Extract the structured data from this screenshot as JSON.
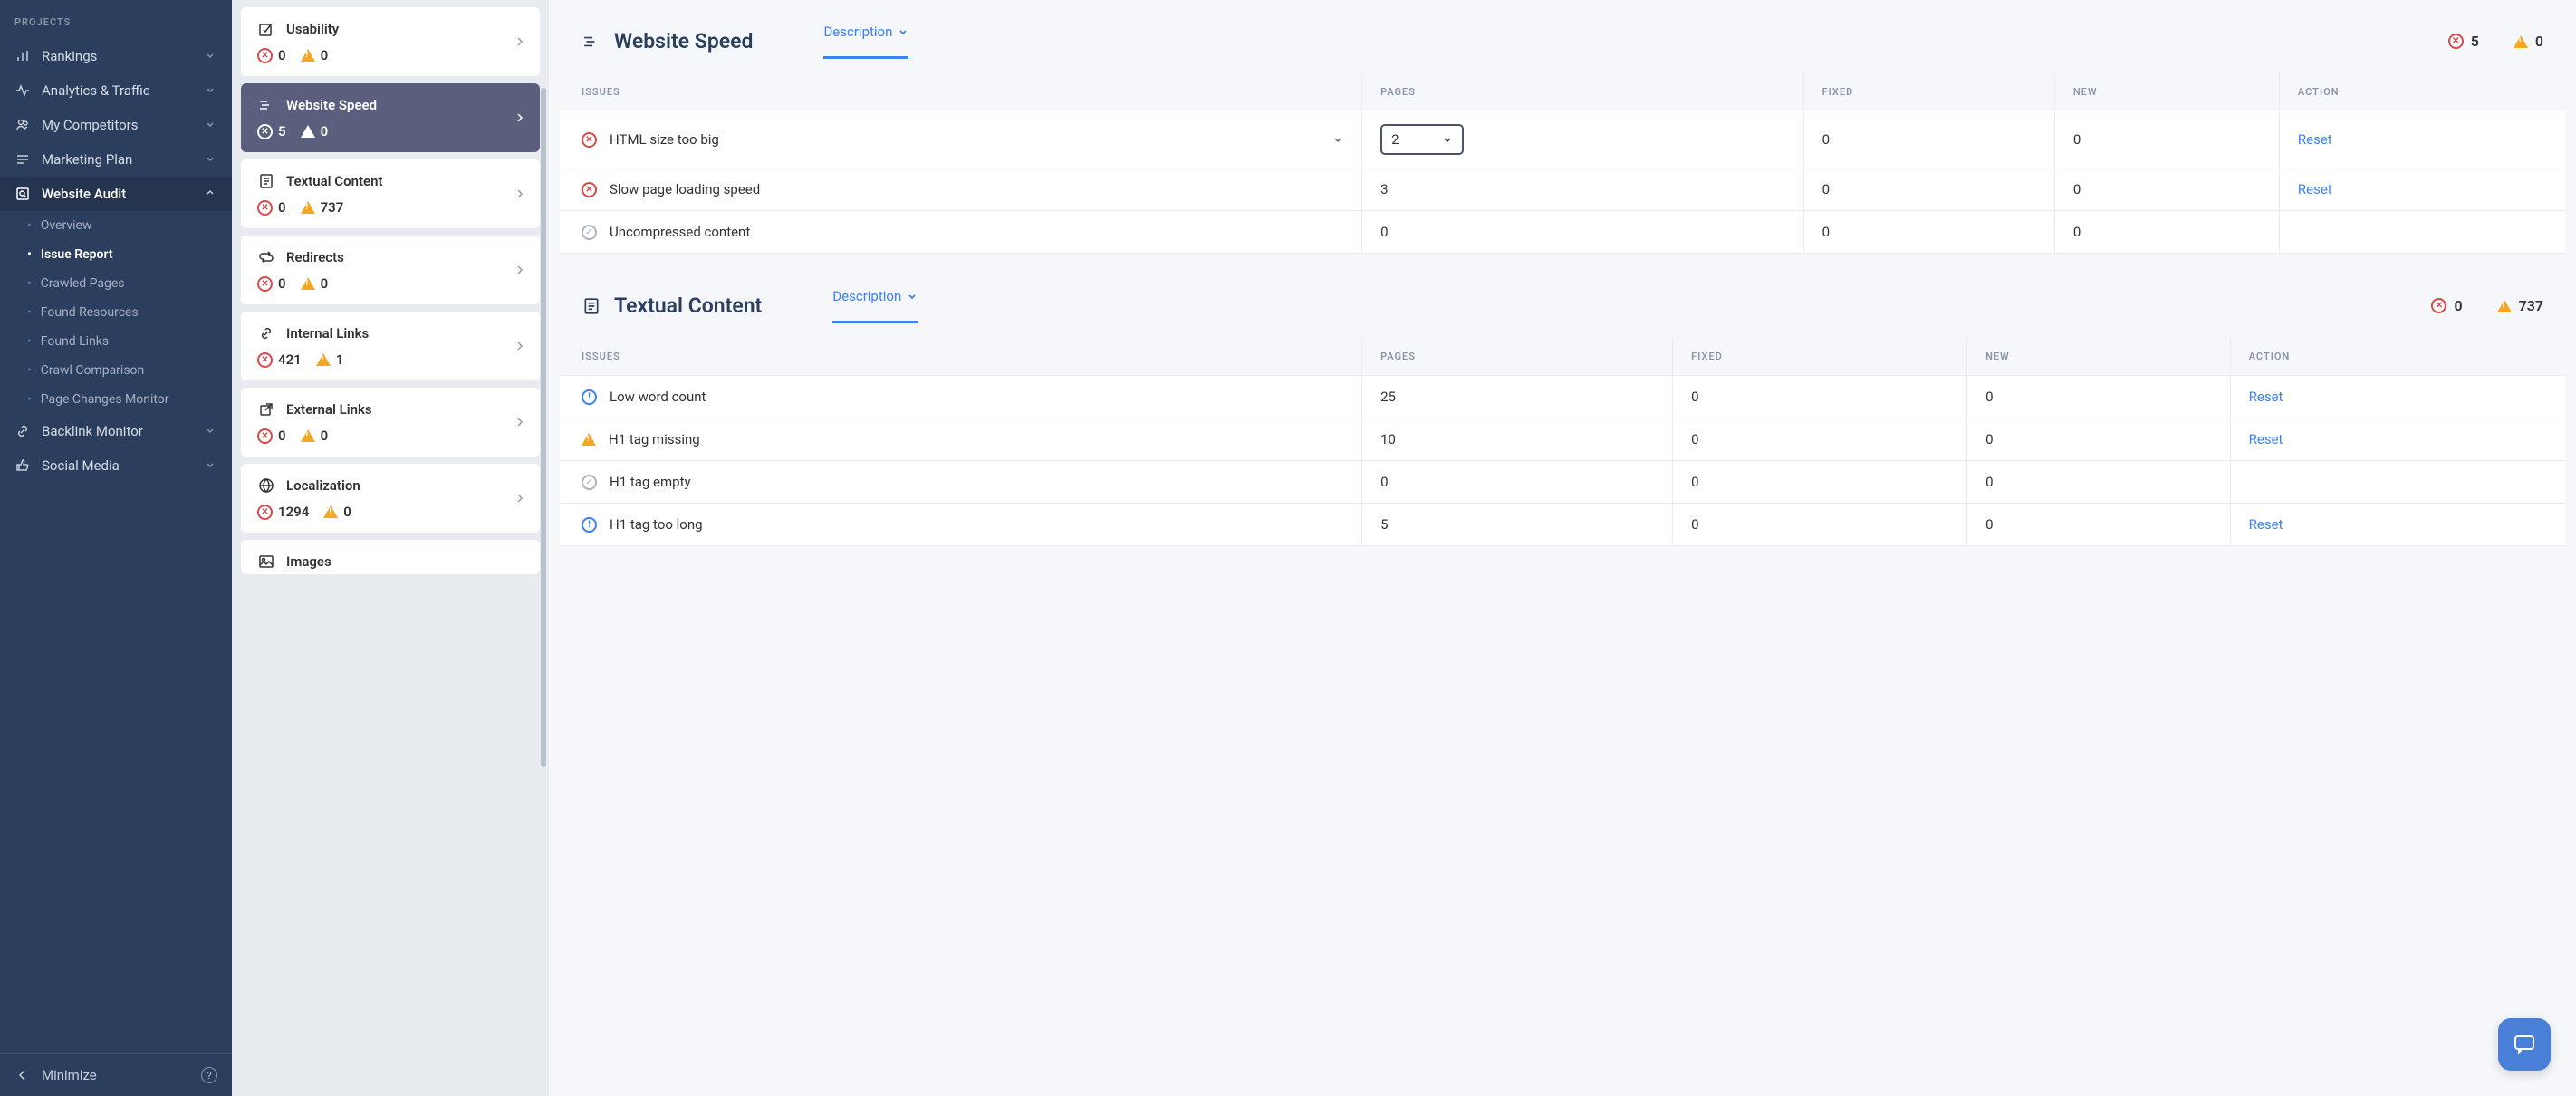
{
  "sidebar": {
    "header": "PROJECTS",
    "items": [
      {
        "label": "Rankings"
      },
      {
        "label": "Analytics & Traffic"
      },
      {
        "label": "My Competitors"
      },
      {
        "label": "Marketing Plan"
      },
      {
        "label": "Website Audit"
      },
      {
        "label": "Backlink Monitor"
      },
      {
        "label": "Social Media"
      }
    ],
    "subnav": [
      {
        "label": "Overview"
      },
      {
        "label": "Issue Report"
      },
      {
        "label": "Crawled Pages"
      },
      {
        "label": "Found Resources"
      },
      {
        "label": "Found Links"
      },
      {
        "label": "Crawl Comparison"
      },
      {
        "label": "Page Changes Monitor"
      }
    ],
    "minimize": "Minimize"
  },
  "categories": [
    {
      "name": "Usability",
      "err": "0",
      "warn": "0"
    },
    {
      "name": "Website Speed",
      "err": "5",
      "warn": "0"
    },
    {
      "name": "Textual Content",
      "err": "0",
      "warn": "737"
    },
    {
      "name": "Redirects",
      "err": "0",
      "warn": "0"
    },
    {
      "name": "Internal Links",
      "err": "421",
      "warn": "1"
    },
    {
      "name": "External Links",
      "err": "0",
      "warn": "0"
    },
    {
      "name": "Localization",
      "err": "1294",
      "warn": "0"
    },
    {
      "name": "Images",
      "err": "",
      "warn": ""
    }
  ],
  "sections": [
    {
      "title": "Website Speed",
      "tab": "Description",
      "err": "5",
      "warn": "0",
      "columns": {
        "issues": "ISSUES",
        "pages": "PAGES",
        "fixed": "FIXED",
        "new": "NEW",
        "action": "ACTION"
      },
      "rows": [
        {
          "icon": "err",
          "name": "HTML size too big",
          "expandable": true,
          "pages": "2",
          "pages_select": true,
          "fixed": "0",
          "new": "0",
          "action": "Reset"
        },
        {
          "icon": "err",
          "name": "Slow page loading speed",
          "pages": "3",
          "fixed": "0",
          "new": "0",
          "action": "Reset"
        },
        {
          "icon": "check",
          "name": "Uncompressed content",
          "pages": "0",
          "fixed": "0",
          "new": "0",
          "action": ""
        }
      ]
    },
    {
      "title": "Textual Content",
      "tab": "Description",
      "err": "0",
      "warn": "737",
      "columns": {
        "issues": "ISSUES",
        "pages": "PAGES",
        "fixed": "FIXED",
        "new": "NEW",
        "action": "ACTION"
      },
      "rows": [
        {
          "icon": "info",
          "name": "Low word count",
          "pages": "25",
          "fixed": "0",
          "new": "0",
          "action": "Reset"
        },
        {
          "icon": "warn",
          "name": "H1 tag missing",
          "pages": "10",
          "fixed": "0",
          "new": "0",
          "action": "Reset"
        },
        {
          "icon": "check",
          "name": "H1 tag empty",
          "pages": "0",
          "fixed": "0",
          "new": "0",
          "action": ""
        },
        {
          "icon": "info",
          "name": "H1 tag too long",
          "pages": "5",
          "fixed": "0",
          "new": "0",
          "action": "Reset"
        }
      ]
    }
  ]
}
